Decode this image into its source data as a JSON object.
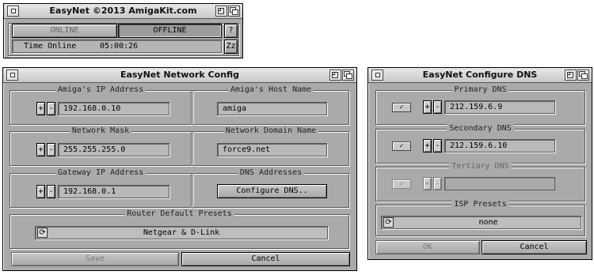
{
  "easynet": {
    "title": "EasyNet ©2013 AmigaKit.com",
    "online_label": "ONLINE",
    "offline_label": "OFFLINE",
    "help_label": "?",
    "time_label": "Time Online",
    "time_value": "05:00:26",
    "zz_label": "Zz"
  },
  "network": {
    "title": "EasyNet Network Config",
    "amiga_ip_label": "Amiga's IP Address",
    "amiga_ip_value": "192.168.0.10",
    "host_name_label": "Amiga's Host Name",
    "host_name_value": "amiga",
    "netmask_label": "Network Mask",
    "netmask_value": "255.255.255.0",
    "domain_label": "Network Domain Name",
    "domain_value": "force9.net",
    "gateway_label": "Gateway IP Address",
    "gateway_value": "192.168.0.1",
    "dns_label": "DNS Addresses",
    "configure_dns_label": "Configure DNS..",
    "router_label": "Router Default Presets",
    "router_value": "Netgear & D-Link",
    "plus": "+",
    "minus": "-",
    "save_label": "Save",
    "cancel_label": "Cancel"
  },
  "dns": {
    "title": "EasyNet Configure DNS",
    "primary_label": "Primary DNS",
    "primary_value": "212.159.6.9",
    "secondary_label": "Secondary DNS",
    "secondary_value": "212.159.6.10",
    "tertiary_label": "Tertiary DNS",
    "tertiary_value": "",
    "isp_label": "ISP Presets",
    "isp_value": "none",
    "ok_label": "OK",
    "cancel_label": "Cancel",
    "checkmark": "✓",
    "plus": "+",
    "minus": "-"
  }
}
